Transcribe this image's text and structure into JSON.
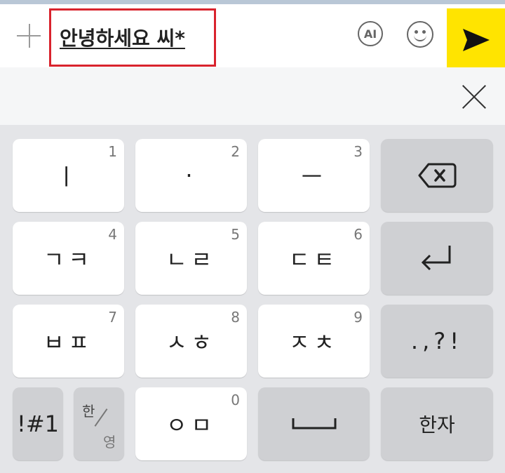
{
  "input": {
    "value": "안녕하세요 씨*",
    "ai_label": "AI"
  },
  "icons": {
    "plus": "plus-icon",
    "emoji": "emoji-icon",
    "send": "send-icon",
    "close": "close-icon",
    "backspace": "backspace-icon",
    "enter": "enter-icon",
    "space": "space-icon"
  },
  "colors": {
    "highlight_border": "#d9232d",
    "send_bg": "#ffe400",
    "key_white": "#ffffff",
    "key_gray": "#cfd0d3",
    "keyboard_bg": "#e4e5e8"
  },
  "keys": {
    "k1": {
      "label": "ㅣ",
      "hint": "1"
    },
    "k2": {
      "label": "·",
      "hint": "2"
    },
    "k3": {
      "label": "ㅡ",
      "hint": "3"
    },
    "k4": {
      "label": "ㄱㅋ",
      "hint": "4"
    },
    "k5": {
      "label": "ㄴㄹ",
      "hint": "5"
    },
    "k6": {
      "label": "ㄷㅌ",
      "hint": "6"
    },
    "k7": {
      "label": "ㅂㅍ",
      "hint": "7"
    },
    "k8": {
      "label": "ㅅㅎ",
      "hint": "8"
    },
    "k9": {
      "label": "ㅈㅊ",
      "hint": "9"
    },
    "k0": {
      "label": "ㅇㅁ",
      "hint": "0"
    },
    "punct": ".,?!",
    "symbols": "!#1",
    "lang_top": "한",
    "lang_bottom": "영",
    "hanja": "한자"
  }
}
